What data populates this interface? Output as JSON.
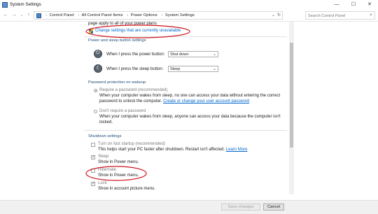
{
  "window": {
    "title": "System Settings"
  },
  "address_bar": {
    "crumbs": [
      "Control Panel",
      "All Control Panel Items",
      "Power Options",
      "System Settings"
    ],
    "search_placeholder": "Search Control Panel"
  },
  "intro_cut": "page apply to all of your power plans.",
  "change_settings_link": "Change settings that are currently unavailable",
  "power_sleep": {
    "header": "Power and sleep button settings",
    "power_label": "When I press the power button:",
    "power_value": "Shut down",
    "sleep_label": "When I press the sleep button:",
    "sleep_value": "Sleep"
  },
  "password": {
    "header": "Password protection on wakeup",
    "require_label": "Require a password (recommended)",
    "require_desc_1": "When your computer wakes from sleep, no one can access your data without entering the correct",
    "require_desc_2": "password to unlock the computer.",
    "require_link": "Create or change your user account password",
    "dont_label": "Don't require a password",
    "dont_desc_1": "When your computer wakes from sleep, anyone can access your data because the computer isn't",
    "dont_desc_2": "locked."
  },
  "shutdown": {
    "header": "Shutdown settings",
    "fast_label": "Turn on fast startup (recommended)",
    "fast_desc": "This helps start your PC faster after shutdown. Restart isn't affected.",
    "fast_link": "Learn More",
    "sleep_label": "Sleep",
    "sleep_desc": "Show in Power menu.",
    "hibernate_label": "Hibernate",
    "hibernate_desc": "Show in Power menu.",
    "lock_label": "Lock",
    "lock_desc": "Show in account picture menu."
  },
  "footer": {
    "save": "Save changes",
    "cancel": "Cancel"
  },
  "colors": {
    "link": "#0066cc",
    "annotation": "#d0141e",
    "header": "#1f4e79"
  }
}
